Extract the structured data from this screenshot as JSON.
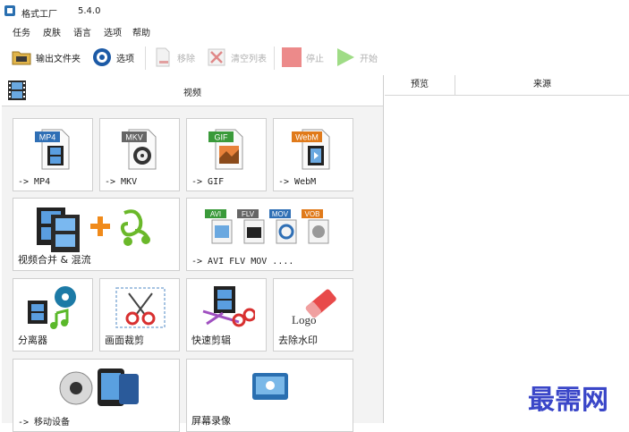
{
  "app": {
    "title": "格式工厂",
    "version": "5.4.0"
  },
  "menu": [
    "任务",
    "皮肤",
    "语言",
    "选项",
    "帮助"
  ],
  "toolbar": {
    "output_folder": "输出文件夹",
    "options": "选项",
    "remove": "移除",
    "clear_list": "清空列表",
    "stop": "停止",
    "start": "开始"
  },
  "category": {
    "label": "视频"
  },
  "tiles": {
    "mp4": "-> MP4",
    "mkv": "-> MKV",
    "gif": "-> GIF",
    "webm": "-> WebM",
    "merge": "视频合并 & 混流",
    "multi": "-> AVI FLV MOV ....",
    "splitter": "分离器",
    "crop": "画面裁剪",
    "quick_clip": "快速剪辑",
    "remove_logo": "去除水印",
    "mobile": "-> 移动设备",
    "screen_record": "屏幕录像"
  },
  "badges": {
    "mp4": "MP4",
    "mkv": "MKV",
    "gif": "GIF",
    "webm": "WebM",
    "avi": "AVI",
    "flv": "FLV",
    "mov": "MOV",
    "vob": "VOB",
    "logo": "Logo"
  },
  "right_panel": {
    "col_preview": "预览",
    "col_source": "来源"
  },
  "watermark": "最需网",
  "colors": {
    "mp4": "#2f6fb5",
    "mkv": "#666666",
    "gif": "#3a9a3a",
    "webm": "#e07a1a",
    "stop": "#e85a5a",
    "start": "#6cc24a",
    "watermark": "#3a46c8"
  }
}
